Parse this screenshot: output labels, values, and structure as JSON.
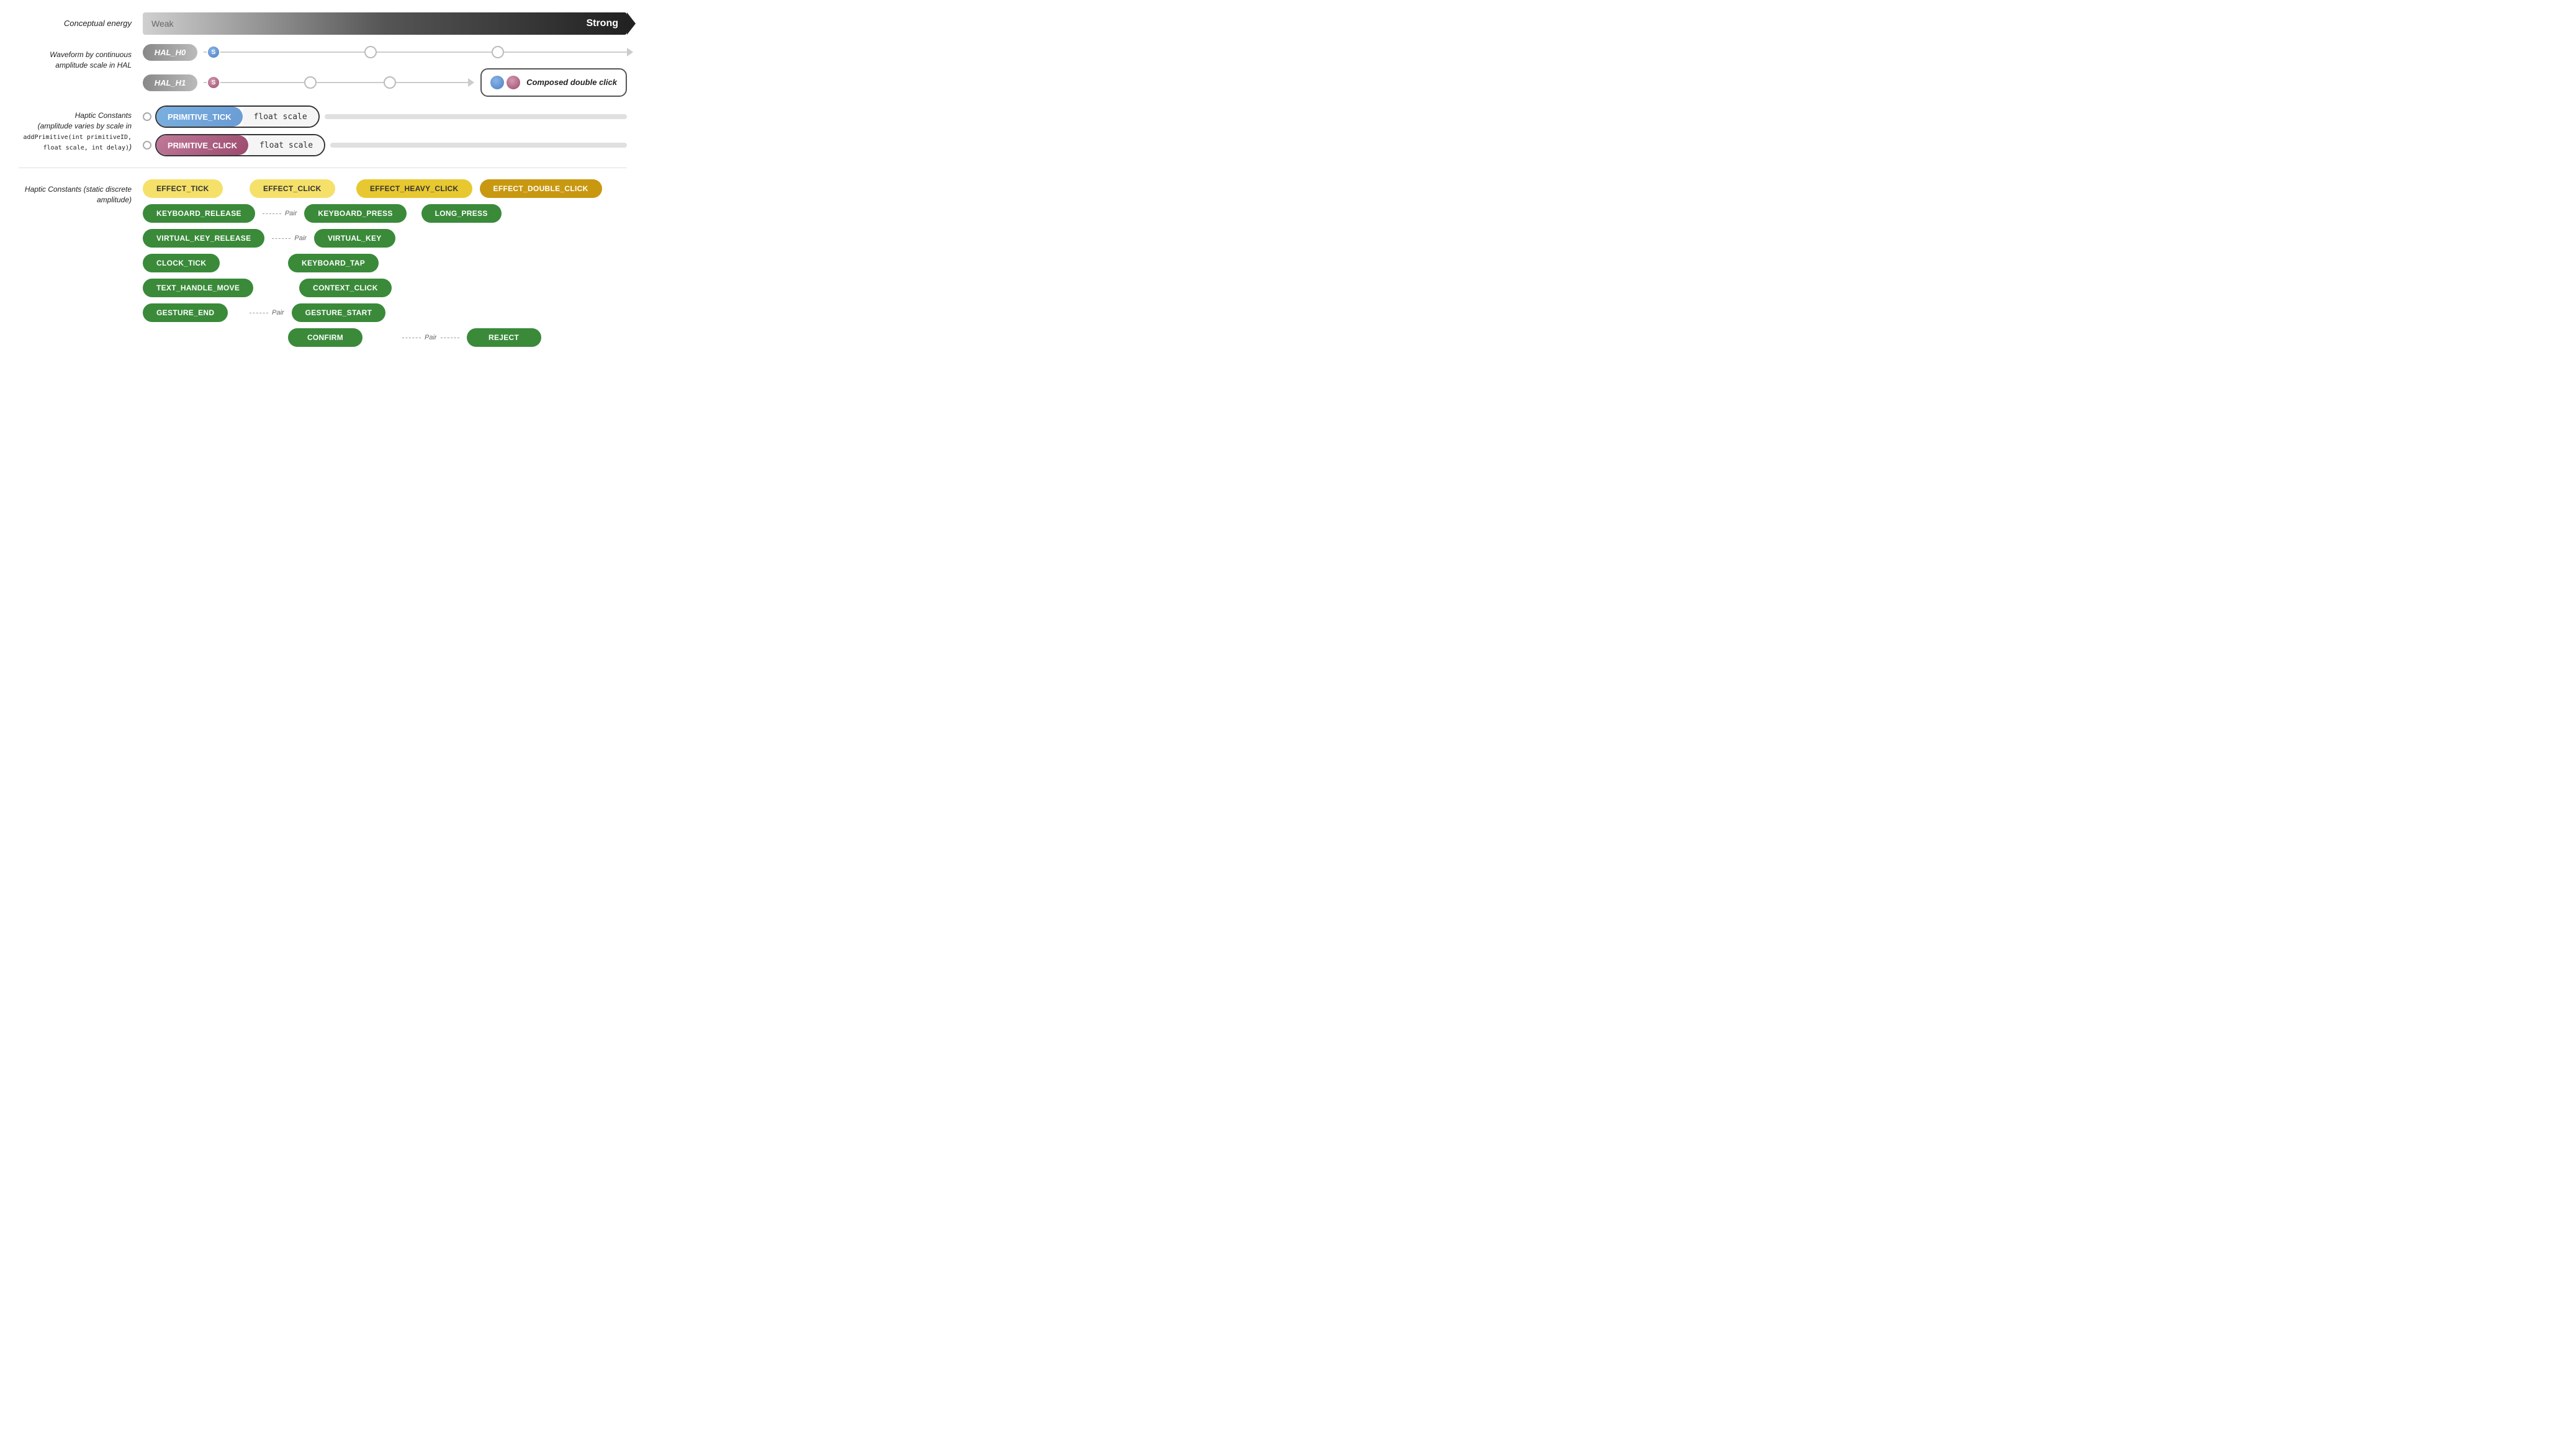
{
  "conceptual_energy": {
    "label": "Conceptual energy",
    "weak": "Weak",
    "strong": "Strong"
  },
  "waveform": {
    "label": "Waveform by continuous amplitude scale in HAL",
    "hal_h0": "HAL_H0",
    "hal_h1": "HAL_H1",
    "s_label": "S"
  },
  "composed": {
    "label": "Composed double click"
  },
  "haptic_scale": {
    "label_part1": "Haptic Constants",
    "label_part2": "(amplitude varies by scale in ",
    "label_code": "addPrimitive(int primitiveID, float scale, int delay)",
    "label_part3": ")",
    "primitive_tick": "PRIMITIVE_TICK",
    "float_scale": "float scale",
    "primitive_click": "PRIMITIVE_CLICK"
  },
  "haptic_discrete": {
    "label": "Haptic Constants (static discrete amplitude)",
    "effects": {
      "effect_tick": "EFFECT_TICK",
      "effect_click": "EFFECT_CLICK",
      "effect_heavy_click": "EFFECT_HEAVY_CLICK",
      "effect_double_click": "EFFECT_DOUBLE_CLICK",
      "keyboard_release": "KEYBOARD_RELEASE",
      "keyboard_press": "KEYBOARD_PRESS",
      "long_press": "LONG_PRESS",
      "virtual_key_release": "VIRTUAL_KEY_RELEASE",
      "virtual_key": "VIRTUAL_KEY",
      "clock_tick": "CLOCK_TICK",
      "keyboard_tap": "KEYBOARD_TAP",
      "text_handle_move": "TEXT_HANDLE_MOVE",
      "context_click": "CONTEXT_CLICK",
      "gesture_end": "GESTURE_END",
      "gesture_start": "GESTURE_START",
      "confirm": "CONFIRM",
      "reject": "REJECT"
    },
    "pair": "Pair"
  }
}
